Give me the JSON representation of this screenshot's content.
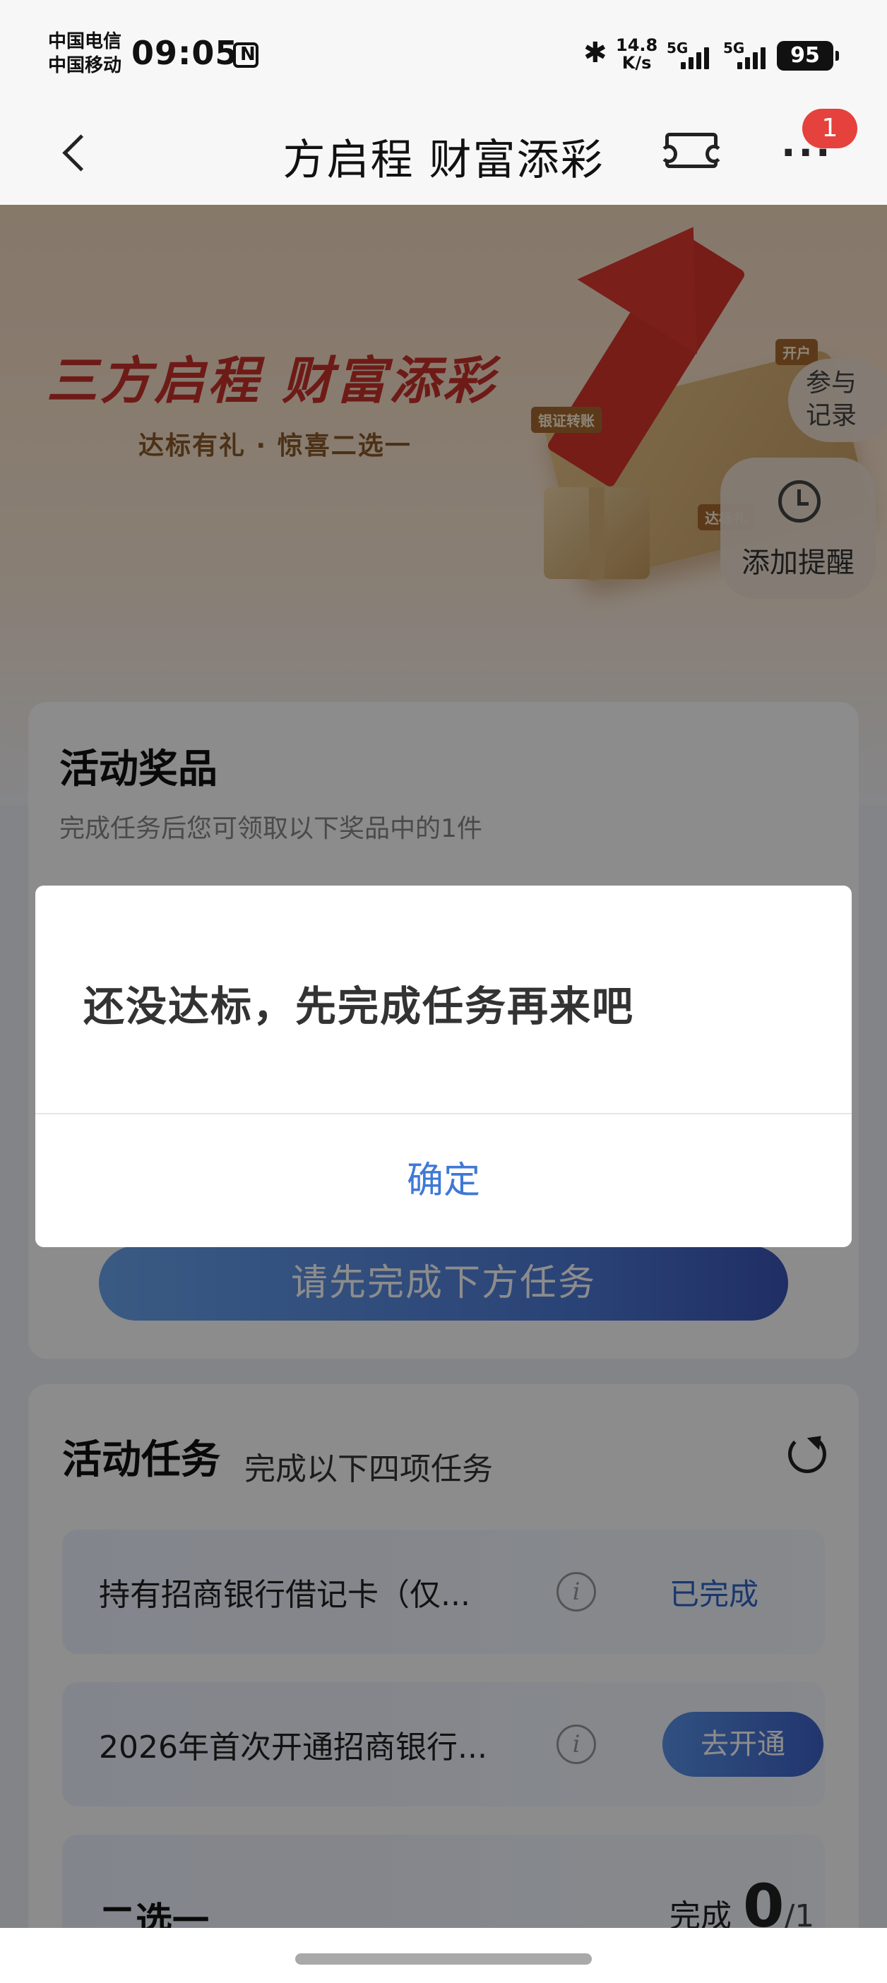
{
  "status_bar": {
    "carrier_1": "中国电信",
    "carrier_2": "中国移动",
    "time": "09:05",
    "net_speed_value": "14.8",
    "net_speed_unit": "K/s",
    "signal_1": "5G",
    "signal_2": "5G",
    "battery": "95"
  },
  "nav": {
    "title": "方启程 财富添彩",
    "badge_count": "1"
  },
  "hero": {
    "title": "三方启程 财富添彩",
    "subtitle": "达标有礼 · 惊喜二选一",
    "tag_transfer": "银证转账",
    "tag_open": "开户",
    "tag_reach": "达标礼",
    "record_label": "参与记录",
    "remind_label": "添加提醒"
  },
  "prize": {
    "title": "活动奖品",
    "description": "完成任务后您可领取以下奖品中的1件",
    "cta_label": "请先完成下方任务"
  },
  "tasks": {
    "title": "活动任务",
    "subtitle": "完成以下四项任务",
    "items": [
      {
        "name": "持有招商银行借记卡（仅...",
        "status": "已完成"
      },
      {
        "name": "2026年首次开通招商银行...",
        "action": "去开通"
      }
    ],
    "group": {
      "title": "二选一",
      "progress_label": "完成",
      "progress_done": "0",
      "progress_total": "/1"
    }
  },
  "dialog": {
    "message": "还没达标，先完成任务再来吧",
    "confirm_label": "确定"
  },
  "colors": {
    "accent_blue": "#3f78d8",
    "badge_red": "#e5413d",
    "hero_red": "#c8322b"
  }
}
